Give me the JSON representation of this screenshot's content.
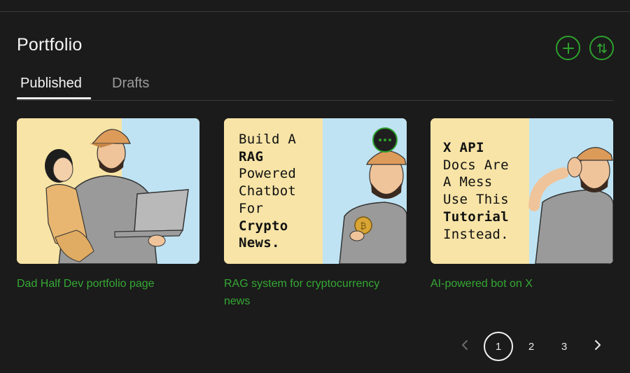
{
  "page": {
    "title": "Portfolio",
    "accent_color": "#2ea02e"
  },
  "actions": {
    "add_icon": "plus-circle-icon",
    "sort_icon": "sort-arrows-icon"
  },
  "tabs": [
    {
      "label": "Published",
      "active": true
    },
    {
      "label": "Drafts",
      "active": false
    }
  ],
  "cards": [
    {
      "title": "Dad Half Dev portfolio page",
      "image": "illustration of a bearded man in an orange cap holding a toddler and a laptop"
    },
    {
      "title": "RAG system for cryptocurrency news",
      "image": "bearded man in orange cap holding a gold bitcoin",
      "thumb_lines": [
        "Build A",
        "RAG",
        "Powered",
        "Chatbot",
        "For",
        "Crypto",
        "News."
      ],
      "more_icon": "more-options-icon"
    },
    {
      "title": "AI-powered bot on X",
      "image": "bearded man in orange cap holding his head in frustration",
      "thumb_lines": [
        "X API",
        "Docs Are",
        "A Mess",
        "Use This",
        "Tutorial",
        "Instead."
      ]
    }
  ],
  "pagination": {
    "prev_icon": "chevron-left-icon",
    "pages": [
      "1",
      "2",
      "3"
    ],
    "current": "1",
    "next_icon": "chevron-right-icon"
  }
}
